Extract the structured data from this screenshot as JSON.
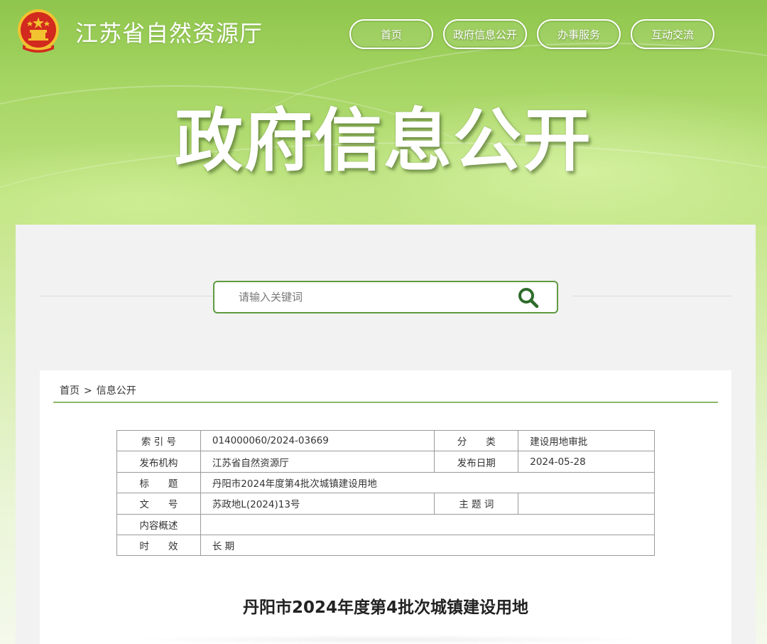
{
  "header": {
    "site_title": "江苏省自然资源厅",
    "banner_title": "政府信息公开",
    "nav": [
      {
        "label": "首页"
      },
      {
        "label": "政府信息公开"
      },
      {
        "label": "办事服务"
      },
      {
        "label": "互动交流"
      }
    ]
  },
  "search": {
    "placeholder": "请输入关键词"
  },
  "breadcrumb": {
    "home": "首页",
    "separator": ">",
    "current": "信息公开"
  },
  "meta": {
    "index_label": "索 引 号",
    "index_value": "014000060/2024-03669",
    "category_label": "分　　类",
    "category_value": "建设用地审批",
    "publisher_label": "发布机构",
    "publisher_value": "江苏省自然资源厅",
    "date_label": "发布日期",
    "date_value": "2024-05-28",
    "title_label": "标　　题",
    "title_value": "丹阳市2024年度第4批次城镇建设用地",
    "doc_no_label": "文　　号",
    "doc_no_value": "苏政地L(2024)13号",
    "keywords_label": "主 题 词",
    "keywords_value": "",
    "summary_label": "内容概述",
    "summary_value": "",
    "validity_label": "时　　效",
    "validity_value": "长 期"
  },
  "article": {
    "title": "丹阳市2024年度第4批次城镇建设用地"
  },
  "colors": {
    "accent_green": "#5f9a3f",
    "emblem_red": "#d22a1e",
    "emblem_gold": "#f2c230"
  }
}
